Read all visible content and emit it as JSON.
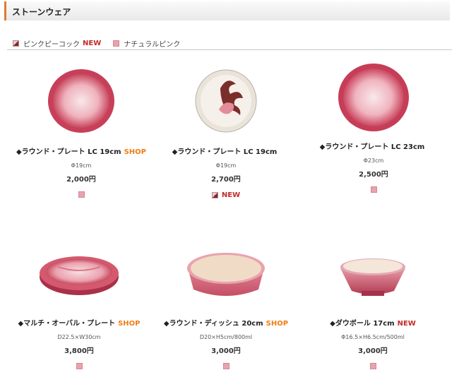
{
  "section": {
    "title": "ストーンウェア"
  },
  "legend": [
    {
      "swatch": "peacock",
      "label": "ピンクピーコック",
      "badge": "NEW"
    },
    {
      "swatch": "natural",
      "label": "ナチュラルピンク",
      "badge": ""
    }
  ],
  "products": [
    {
      "name": "◆ラウンド・プレート LC 19cm",
      "tag": "SHOP",
      "size": "Φ19cm",
      "price": "2,000円",
      "colors": [
        "natural"
      ],
      "colors_tag": "",
      "icon": "plate-pink-icon"
    },
    {
      "name": "◆ラウンド・プレート LC 19cm",
      "tag": "",
      "size": "Φ19cm",
      "price": "2,700円",
      "colors": [
        "peacock"
      ],
      "colors_tag": "NEW",
      "icon": "plate-peacock-icon"
    },
    {
      "name": "◆ラウンド・プレート LC 23cm",
      "tag": "",
      "size": "Φ23cm",
      "price": "2,500円",
      "colors": [
        "natural"
      ],
      "colors_tag": "",
      "icon": "plate-pink-icon"
    },
    {
      "name": "◆マルチ・オーバル・プレート",
      "tag": "SHOP",
      "size": "D22.5×W30cm",
      "price": "3,800円",
      "colors": [
        "natural"
      ],
      "colors_tag": "",
      "icon": "oval-plate-icon"
    },
    {
      "name": "◆ラウンド・ディッシュ 20cm",
      "tag": "SHOP",
      "size": "D20×H5cm/800ml",
      "price": "3,000円",
      "colors": [
        "natural"
      ],
      "colors_tag": "",
      "icon": "dish-icon"
    },
    {
      "name": "◆ダウボール 17cm",
      "tag": "NEW",
      "size": "Φ16.5×H6.5cm/500ml",
      "price": "3,000円",
      "colors": [
        "natural"
      ],
      "colors_tag": "",
      "icon": "bowl-icon"
    }
  ],
  "colors": {
    "accent_shop": "#f07d14",
    "accent_new": "#c42a2a",
    "header_bar": "#e07a2f"
  }
}
